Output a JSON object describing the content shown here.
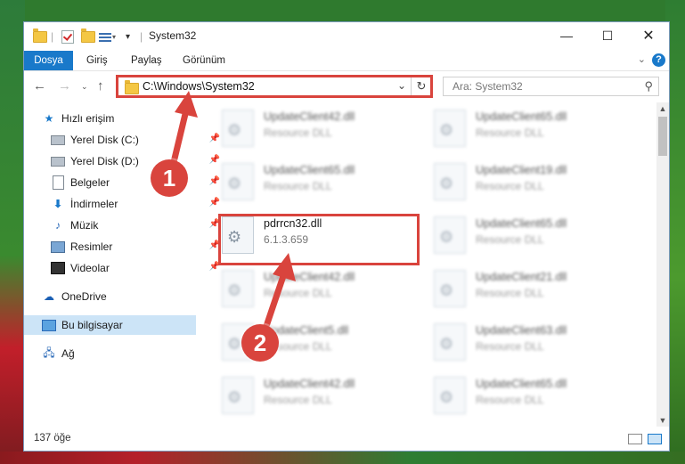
{
  "window": {
    "title": "System32"
  },
  "ribbon": {
    "tabs": [
      "Dosya",
      "Giriş",
      "Paylaş",
      "Görünüm"
    ]
  },
  "nav": {
    "address": "C:\\Windows\\System32",
    "search_placeholder": "Ara: System32"
  },
  "sidebar": {
    "items": [
      {
        "label": "Hızlı erişim",
        "icon": "star-icon"
      },
      {
        "label": "Yerel Disk (C:)",
        "icon": "drive-icon",
        "pinned": true
      },
      {
        "label": "Yerel Disk (D:)",
        "icon": "drive-icon",
        "pinned": true
      },
      {
        "label": "Belgeler",
        "icon": "documents-icon",
        "pinned": true
      },
      {
        "label": "İndirmeler",
        "icon": "download-icon",
        "pinned": true
      },
      {
        "label": "Müzik",
        "icon": "music-icon",
        "pinned": true
      },
      {
        "label": "Resimler",
        "icon": "pictures-icon",
        "pinned": true
      },
      {
        "label": "Videolar",
        "icon": "videos-icon",
        "pinned": true
      },
      {
        "label": "OneDrive",
        "icon": "cloud-icon"
      },
      {
        "label": "Bu bilgisayar",
        "icon": "computer-icon",
        "selected": true
      },
      {
        "label": "Ağ",
        "icon": "network-icon"
      }
    ]
  },
  "files": [
    {
      "name": "UpdateClient42.dll",
      "desc": "Resource DLL",
      "blurred": true
    },
    {
      "name": "UpdateClient65.dll",
      "desc": "Resource DLL",
      "blurred": true
    },
    {
      "name": "UpdateClient65.dll",
      "desc": "Resource DLL",
      "blurred": true
    },
    {
      "name": "UpdateClient19.dll",
      "desc": "Resource DLL",
      "blurred": true
    },
    {
      "name": "pdrrcn32.dll",
      "desc": "6.1.3.659",
      "blurred": false
    },
    {
      "name": "UpdateClient65.dll",
      "desc": "Resource DLL",
      "blurred": true
    },
    {
      "name": "UpdateClient42.dll",
      "desc": "Resource DLL",
      "blurred": true
    },
    {
      "name": "UpdateClient21.dll",
      "desc": "Resource DLL",
      "blurred": true
    },
    {
      "name": "UpdateClient5.dll",
      "desc": "Resource DLL",
      "blurred": true
    },
    {
      "name": "UpdateClient63.dll",
      "desc": "Resource DLL",
      "blurred": true
    },
    {
      "name": "UpdateClient42.dll",
      "desc": "Resource DLL",
      "blurred": true
    },
    {
      "name": "UpdateClient65.dll",
      "desc": "Resource DLL",
      "blurred": true
    }
  ],
  "status": {
    "count": "137 öğe"
  },
  "callouts": [
    "1",
    "2"
  ],
  "colors": {
    "accent": "#1979ca",
    "highlight": "#d9443d",
    "selected": "#cce4f7"
  }
}
